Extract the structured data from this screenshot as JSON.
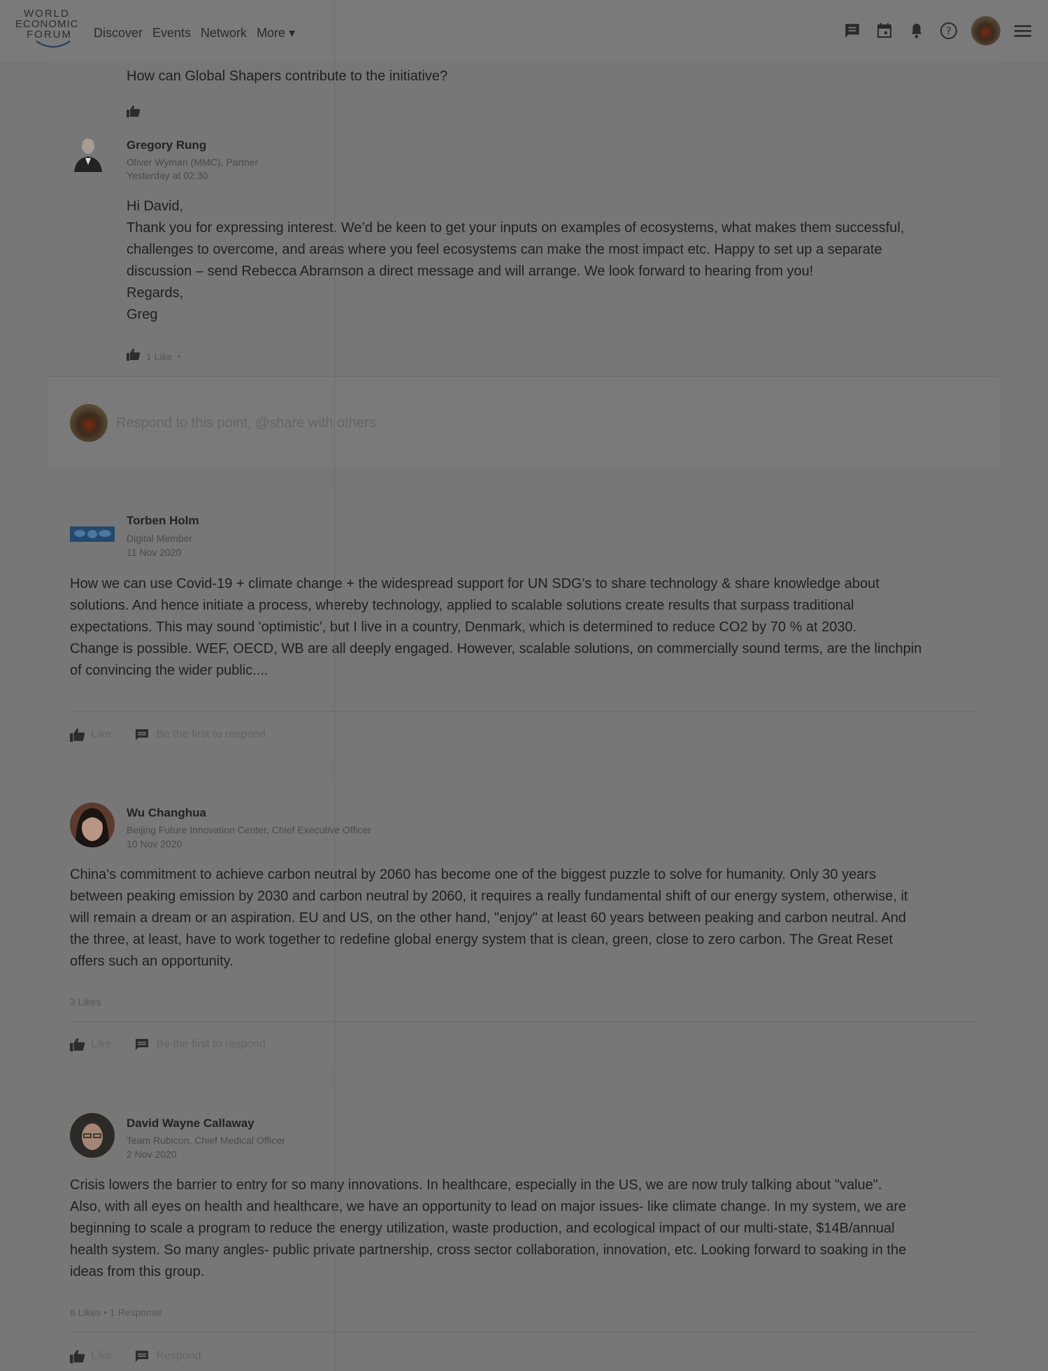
{
  "header": {
    "logo": {
      "line1": "WORLD",
      "line2": "ECONOMIC",
      "line3": "FORUM"
    },
    "nav": [
      "Discover",
      "Events",
      "Network",
      "More ▾"
    ]
  },
  "thread": {
    "question": "How can Global Shapers contribute to the initiative?",
    "reply": {
      "author": "Gregory Rung",
      "role": "Oliver Wyman (MMC), Partner",
      "time": "Yesterday at 02:30",
      "lines": [
        "Hi David,",
        "Thank you for expressing interest. We’d be keen to get your inputs on examples of ecosystems, what makes them successful,",
        "challenges to overcome, and areas where you feel ecosystems can make the most impact etc. Happy to set up a separate",
        "discussion – send Rebecca Abramson a direct message and will arrange. We look forward to hearing from you!",
        "Regards,",
        "Greg"
      ],
      "likes": "1 Like",
      "dot": "•"
    },
    "respond_placeholder": "Respond to this point, @share with others"
  },
  "posts": [
    {
      "author": "Torben Holm",
      "role": "Digital Member",
      "date": "11 Nov 2020",
      "lines": [
        "How we can use Covid-19 + climate change + the widespread support for UN SDG's to share technology & share knowledge about",
        "solutions. And hence initiate a process, whereby technology, applied to scalable solutions create results that surpass traditional",
        "expectations. This may sound 'optimistic', but I live in a country, Denmark, which is determined to reduce CO2 by 70 % at 2030.",
        "Change is possible. WEF, OECD, WB are all deeply engaged. However, scalable solutions, on commercially sound terms, are the linchpin",
        "of convincing the wider public...."
      ],
      "like_label": "Like",
      "respond_label": "Be the first to respond"
    },
    {
      "author": "Wu Changhua",
      "role": "Beijing Future Innovation Center, Chief Executive Officer",
      "date": "10 Nov 2020",
      "lines": [
        "China's commitment to achieve carbon neutral by 2060 has become one of the biggest puzzle to solve for humanity. Only 30 years",
        "between peaking emission by 2030 and carbon neutral by 2060, it requires a really fundamental shift of our energy system, otherwise, it",
        "will remain a dream or an aspiration. EU and US, on the other hand, \"enjoy\" at least 60 years between peaking and carbon neutral. And",
        "the three, at least, have to work together to redefine global energy system that is clean, green, close to zero carbon. The Great Reset",
        "offers such an opportunity."
      ],
      "stats": "3 Likes",
      "like_label": "Like",
      "respond_label": "Be the first to respond"
    },
    {
      "author": "David Wayne Callaway",
      "role": "Team Rubicon, Chief Medical Officer",
      "date": "2 Nov 2020",
      "lines": [
        "Crisis lowers the barrier to entry for so many innovations. In healthcare, especially in the US, we are now truly talking about \"value\".",
        "Also, with all eyes on health and healthcare, we have an opportunity to lead on major issues- like climate change. In my system, we are",
        "beginning to scale a program to reduce the energy utilization, waste production, and ecological impact of our multi-state, $14B/annual",
        "health system. So many angles- public private partnership, cross sector collaboration, innovation, etc. Looking forward to soaking in the",
        "ideas from this group."
      ],
      "stats": "6 Likes • 1 Response",
      "like_label": "Like",
      "respond_label": "Respond"
    }
  ]
}
